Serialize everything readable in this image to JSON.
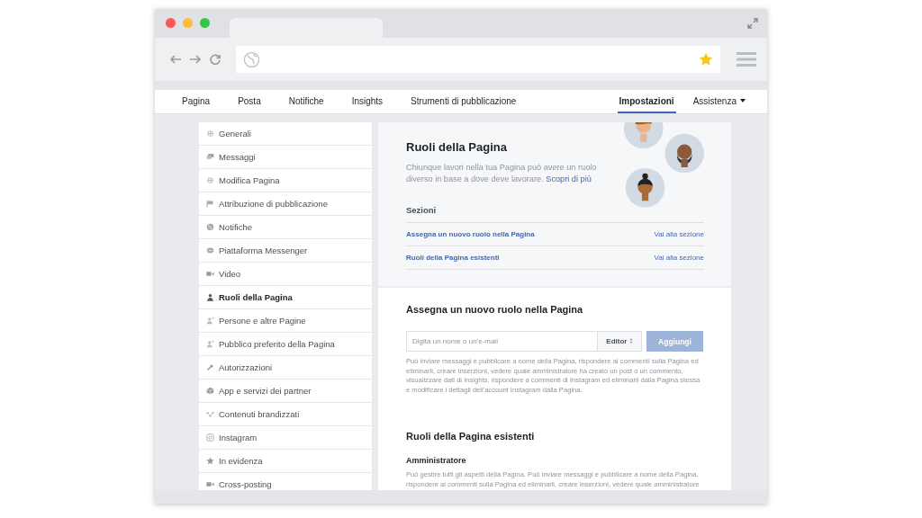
{
  "nav": {
    "tabs": [
      {
        "label": "Pagina",
        "selected": false
      },
      {
        "label": "Posta",
        "selected": false
      },
      {
        "label": "Notifiche",
        "selected": false
      },
      {
        "label": "Insights",
        "selected": false
      },
      {
        "label": "Strumenti di pubblicazione",
        "selected": false
      }
    ],
    "right_tabs": [
      {
        "label": "Impostazioni",
        "selected": true,
        "dropdown": false
      },
      {
        "label": "Assistenza",
        "selected": false,
        "dropdown": true
      }
    ]
  },
  "sidebar": {
    "items": [
      {
        "label": "Generali",
        "kind": "gear",
        "selected": false
      },
      {
        "label": "Messaggi",
        "kind": "chat",
        "selected": false
      },
      {
        "label": "Modifica Pagina",
        "kind": "gear",
        "selected": false
      },
      {
        "label": "Attribuzione di pubblicazione",
        "kind": "flag",
        "selected": false
      },
      {
        "label": "Notifiche",
        "kind": "globe",
        "selected": false
      },
      {
        "label": "Piattaforma Messenger",
        "kind": "bubble",
        "selected": false
      },
      {
        "label": "Video",
        "kind": "video",
        "selected": false
      },
      {
        "label": "Ruoli della Pagina",
        "kind": "person",
        "selected": true
      },
      {
        "label": "Persone e altre Pagine",
        "kind": "person-plus",
        "selected": false
      },
      {
        "label": "Pubblico preferito della Pagina",
        "kind": "person-plus",
        "selected": false
      },
      {
        "label": "Autorizzazioni",
        "kind": "wrench",
        "selected": false
      },
      {
        "label": "App e servizi dei partner",
        "kind": "box",
        "selected": false
      },
      {
        "label": "Contenuti brandizzati",
        "kind": "share",
        "selected": false
      },
      {
        "label": "Instagram",
        "kind": "camera",
        "selected": false
      },
      {
        "label": "In evidenza",
        "kind": "star",
        "selected": false
      },
      {
        "label": "Cross-posting",
        "kind": "video",
        "selected": false
      }
    ]
  },
  "header": {
    "title": "Ruoli della Pagina",
    "description": "Chiunque lavori nella tua Pagina può avere un ruolo diverso in base a dove deve lavorare.",
    "link": "Scopri di più",
    "sections_title": "Sezioni",
    "sections": [
      {
        "label": "Assegna un nuovo ruolo nella Pagina",
        "action": "Vai alla sezione"
      },
      {
        "label": "Ruoli della Pagina esistenti",
        "action": "Vai alla sezione"
      }
    ]
  },
  "assign": {
    "title": "Assegna un nuovo ruolo nella Pagina",
    "placeholder": "Digita un nome o un'e-mail",
    "role": "Editor",
    "button": "Aggiungi",
    "button_disabled": true,
    "help": "Può inviare messaggi e pubblicare a nome della Pagina, rispondere ai commenti sulla Pagina ed eliminarli, creare inserzioni, vedere quale amministratore ha creato un post o un commento, visualizzare dati di Insights, rispondere a commenti di Instagram ed eliminarli dalla Pagina stessa e modificare i dettagli dell'account Instagram dalla Pagina."
  },
  "existing": {
    "title": "Ruoli della Pagina esistenti",
    "role_title": "Amministratore",
    "role_text": "Può gestire tutti gli aspetti della Pagina. Può inviare messaggi e pubblicare a nome della Pagina, rispondere ai commenti sulla Pagina ed eliminarli, creare inserzioni, vedere quale amministratore"
  }
}
